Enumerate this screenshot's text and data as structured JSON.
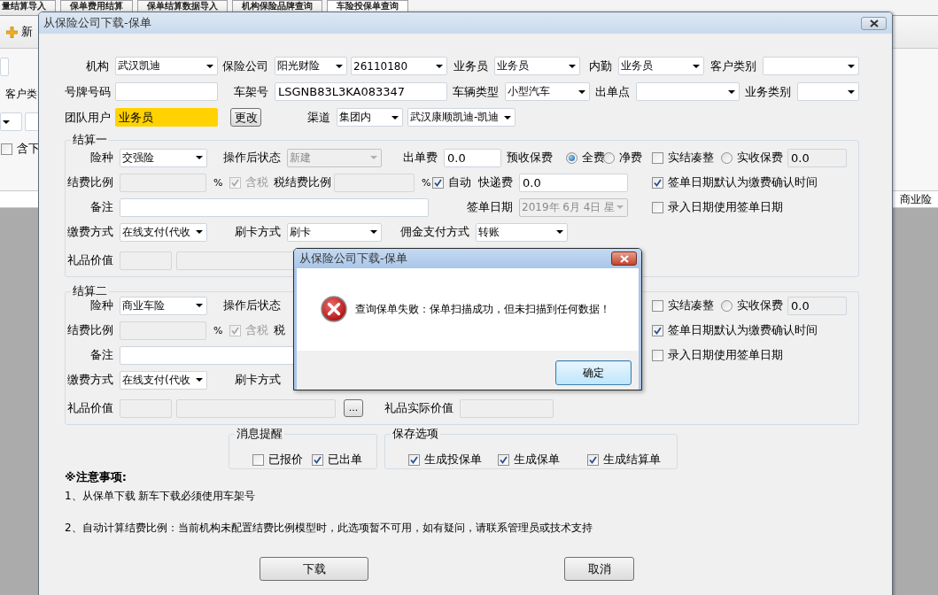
{
  "background": {
    "tabs": [
      {
        "label": "量结算导入",
        "selected": false
      },
      {
        "label": "保单费用结算",
        "selected": false
      },
      {
        "label": "保单结算数据导入",
        "selected": false
      },
      {
        "label": "机构保险品牌查询",
        "selected": false
      },
      {
        "label": "车险投保单查询",
        "selected": true
      }
    ],
    "toolbar_button": "新",
    "filter_label": "客户类",
    "filter_checkbox": {
      "label": "含下",
      "checked": false
    },
    "column_header": "商业险"
  },
  "dialog": {
    "title": "从保险公司下载-保单",
    "header_rows": [
      {
        "items": [
          {
            "kind": "label",
            "text": "机构"
          },
          {
            "kind": "select",
            "value": "武汉凯迪",
            "disabled": false
          },
          {
            "kind": "label",
            "text": "保险公司"
          },
          {
            "kind": "select",
            "value": "阳光财险",
            "disabled": false
          },
          {
            "kind": "select",
            "value": "26110180",
            "disabled": false
          },
          {
            "kind": "label",
            "text": "业务员"
          },
          {
            "kind": "select",
            "value": "业务员",
            "disabled": false
          },
          {
            "kind": "label",
            "text": "内勤"
          },
          {
            "kind": "select",
            "value": "业务员",
            "disabled": false
          },
          {
            "kind": "label",
            "text": "客户类别"
          },
          {
            "kind": "select",
            "disabled": false
          }
        ]
      },
      {
        "items": [
          {
            "kind": "label",
            "text": "号牌号码"
          },
          {
            "kind": "input",
            "disabled": false
          },
          {
            "kind": "label",
            "text": "车架号"
          },
          {
            "kind": "input",
            "value": "LSGNB83L3KA083347",
            "disabled": false
          },
          {
            "kind": "label",
            "text": "车辆类型"
          },
          {
            "kind": "select",
            "value": "小型汽车",
            "disabled": false
          },
          {
            "kind": "label",
            "text": "出单点"
          },
          {
            "kind": "select",
            "disabled": false
          },
          {
            "kind": "label",
            "text": "业务类别"
          },
          {
            "kind": "select",
            "disabled": false
          }
        ]
      },
      {
        "items": [
          {
            "kind": "label",
            "text": "团队用户"
          },
          {
            "kind": "input",
            "value": "业务员",
            "disabled": false,
            "highlighted": true
          },
          {
            "kind": "button",
            "label": "更改"
          },
          {
            "kind": "label",
            "text": "渠道"
          },
          {
            "kind": "select",
            "value": "集团内",
            "disabled": false
          },
          {
            "kind": "select",
            "value": "武汉康顺凯迪-凯迪",
            "disabled": false
          }
        ]
      }
    ],
    "sections": [
      {
        "title": "结算一",
        "rows": [
          {
            "main": [
              {
                "kind": "label",
                "text": "险种"
              },
              {
                "kind": "select",
                "value": "交强险",
                "disabled": false
              },
              {
                "kind": "label",
                "text": "操作后状态"
              },
              {
                "kind": "select",
                "value": "新建",
                "disabled": true
              },
              {
                "kind": "label",
                "text": "出单费"
              },
              {
                "kind": "input",
                "value": "0.0",
                "disabled": false
              },
              {
                "kind": "label",
                "text": "预收保费"
              },
              {
                "kind": "radio",
                "label": "全费",
                "selected": true
              },
              {
                "kind": "radio",
                "label": "净费",
                "selected": false
              }
            ],
            "side": [
              {
                "kind": "check",
                "label": "实结凑整",
                "checked": false,
                "disabled": false
              },
              {
                "kind": "radio",
                "label": "实收保费",
                "selected": false
              },
              {
                "kind": "input",
                "value": "0.0",
                "disabled": false,
                "readonly": true
              }
            ]
          },
          {
            "main": [
              {
                "kind": "label",
                "text": "结费比例"
              },
              {
                "kind": "input",
                "disabled": true
              },
              {
                "kind": "unit",
                "text": "%"
              },
              {
                "kind": "check",
                "label": "含税",
                "checked": true,
                "disabled": true
              },
              {
                "kind": "label",
                "text": "税结费比例"
              },
              {
                "kind": "input",
                "disabled": true
              },
              {
                "kind": "unit",
                "text": "%"
              },
              {
                "kind": "check",
                "label": "自动",
                "checked": true,
                "disabled": false
              },
              {
                "kind": "label",
                "text": "快递费"
              },
              {
                "kind": "input",
                "value": "0.0",
                "disabled": false
              }
            ],
            "side": [
              {
                "kind": "check",
                "label": "签单日期默认为缴费确认时间",
                "checked": true,
                "disabled": false
              }
            ]
          },
          {
            "main": [
              {
                "kind": "label",
                "text": "备注"
              },
              {
                "kind": "input",
                "disabled": false
              },
              {
                "kind": "label",
                "text": "签单日期"
              },
              {
                "kind": "select",
                "value": "2019年 6月 4日 星",
                "disabled": true
              }
            ],
            "side": [
              {
                "kind": "check",
                "label": "录入日期使用签单日期",
                "checked": false,
                "disabled": false
              }
            ]
          },
          {
            "main": [
              {
                "kind": "label",
                "text": "缴费方式"
              },
              {
                "kind": "select",
                "value": "在线支付(代收",
                "disabled": false
              },
              {
                "kind": "label",
                "text": "刷卡方式"
              },
              {
                "kind": "select",
                "value": "刷卡",
                "disabled": false
              },
              {
                "kind": "label",
                "text": "佣金支付方式"
              },
              {
                "kind": "select",
                "value": "转账",
                "disabled": false
              }
            ]
          },
          {
            "main": [
              {
                "kind": "label",
                "text": "礼品价值"
              },
              {
                "kind": "input",
                "disabled": true
              },
              {
                "kind": "input",
                "disabled": true
              }
            ]
          }
        ]
      },
      {
        "title": "结算二",
        "rows": [
          {
            "main": [
              {
                "kind": "label",
                "text": "险种"
              },
              {
                "kind": "select",
                "value": "商业车险",
                "disabled": false
              },
              {
                "kind": "label",
                "text": "操作后状态"
              }
            ],
            "side": [
              {
                "kind": "check",
                "label": "实结凑整",
                "checked": false,
                "disabled": false
              },
              {
                "kind": "radio",
                "label": "实收保费",
                "selected": false
              },
              {
                "kind": "input",
                "value": "0.0",
                "disabled": false,
                "readonly": true
              }
            ]
          },
          {
            "main": [
              {
                "kind": "label",
                "text": "结费比例"
              },
              {
                "kind": "input",
                "disabled": true
              },
              {
                "kind": "unit",
                "text": "%"
              },
              {
                "kind": "check",
                "label": "含税",
                "checked": true,
                "disabled": true
              },
              {
                "kind": "label",
                "text": "税"
              }
            ],
            "side": [
              {
                "kind": "check",
                "label": "签单日期默认为缴费确认时间",
                "checked": true,
                "disabled": false
              }
            ]
          },
          {
            "main": [
              {
                "kind": "label",
                "text": "备注"
              },
              {
                "kind": "input",
                "disabled": false
              }
            ],
            "side": [
              {
                "kind": "check",
                "label": "录入日期使用签单日期",
                "checked": false,
                "disabled": false
              }
            ]
          },
          {
            "main": [
              {
                "kind": "label",
                "text": "缴费方式"
              },
              {
                "kind": "select",
                "value": "在线支付(代收",
                "disabled": false
              },
              {
                "kind": "label",
                "text": "刷卡方式"
              }
            ]
          },
          {
            "main": [
              {
                "kind": "label",
                "text": "礼品价值"
              },
              {
                "kind": "input",
                "disabled": true
              },
              {
                "kind": "input",
                "disabled": true
              },
              {
                "kind": "button",
                "label": "..."
              },
              {
                "kind": "label",
                "text": "礼品实际价值"
              },
              {
                "kind": "input",
                "disabled": true
              }
            ]
          }
        ]
      }
    ],
    "option_groups": [
      {
        "title": "消息提醒",
        "options": [
          {
            "label": "已报价",
            "checked": false
          },
          {
            "label": "已出单",
            "checked": true
          }
        ]
      },
      {
        "title": "保存选项",
        "options": [
          {
            "label": "生成投保单",
            "checked": true
          },
          {
            "label": "生成保单",
            "checked": true
          },
          {
            "label": "生成结算单",
            "checked": true
          }
        ]
      }
    ],
    "notes": {
      "title": "※注意事项:",
      "lines": [
        "1、从保单下载 新车下载必须使用车架号",
        "2、自动计算结费比例：当前机构未配置结费比例模型时，此选项暂不可用，如有疑问，请联系管理员或技术支持"
      ]
    },
    "buttons": [
      "下载",
      "取消"
    ]
  },
  "message_box": {
    "title": "从保险公司下载-保单",
    "message": "查询保单失败：保单扫描成功，但未扫描到任何数据！",
    "button": "确定"
  }
}
